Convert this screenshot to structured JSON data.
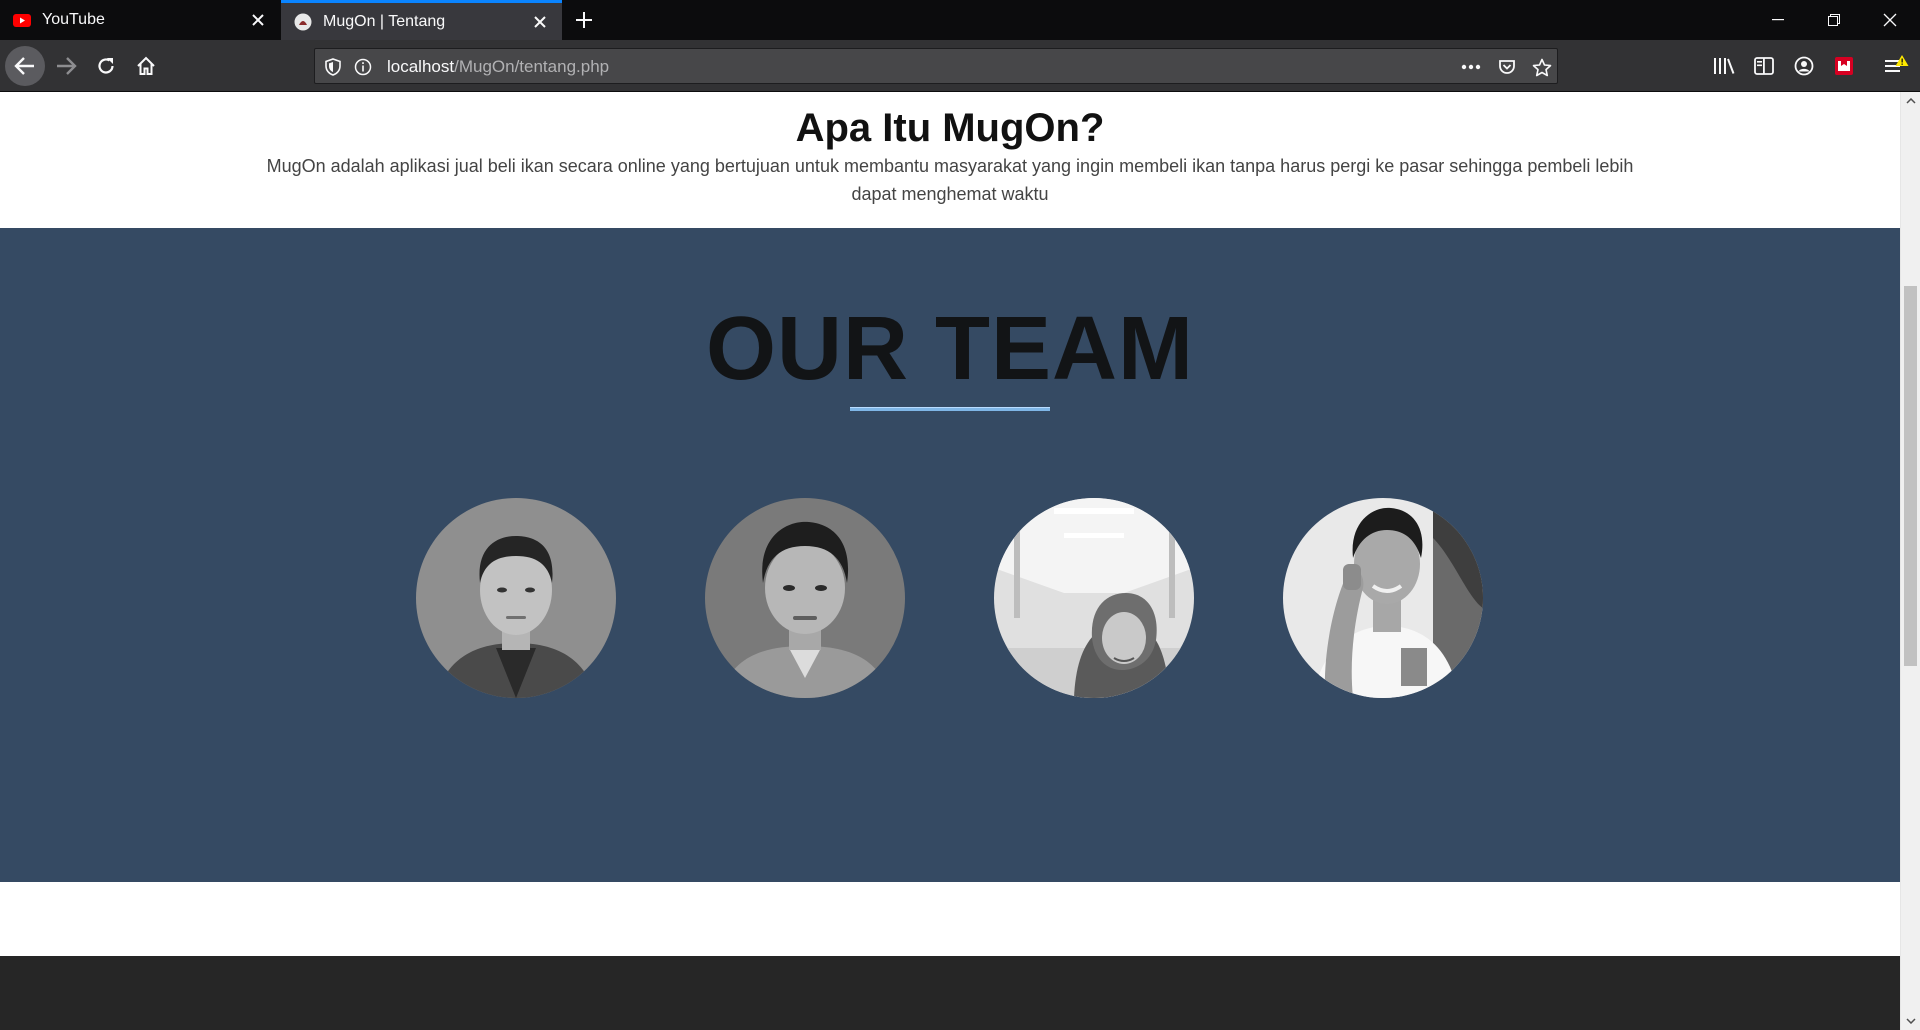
{
  "browser": {
    "tabs": [
      {
        "title": "YouTube",
        "favicon": "youtube-icon",
        "active": false
      },
      {
        "title": "MugOn | Tentang",
        "favicon": "mugon-favicon",
        "active": true
      }
    ],
    "url": {
      "host": "localhost",
      "path": "/MugOn/tentang.php"
    },
    "colors": {
      "tab_accent": "#0a84ff",
      "toolbar": "#323234"
    }
  },
  "page": {
    "about": {
      "title": "Apa Itu MugOn?",
      "text": "MugOn adalah aplikasi jual beli ikan secara online yang bertujuan untuk membantu masyarakat yang ingin membeli ikan tanpa harus pergi ke pasar sehingga pembeli lebih dapat menghemat waktu"
    },
    "team": {
      "title": "OUR TEAM",
      "background": "#354a63",
      "members": [
        {
          "photo": "grayscale portrait"
        },
        {
          "photo": "grayscale portrait"
        },
        {
          "photo": "grayscale portrait"
        },
        {
          "photo": "grayscale portrait"
        }
      ]
    }
  }
}
